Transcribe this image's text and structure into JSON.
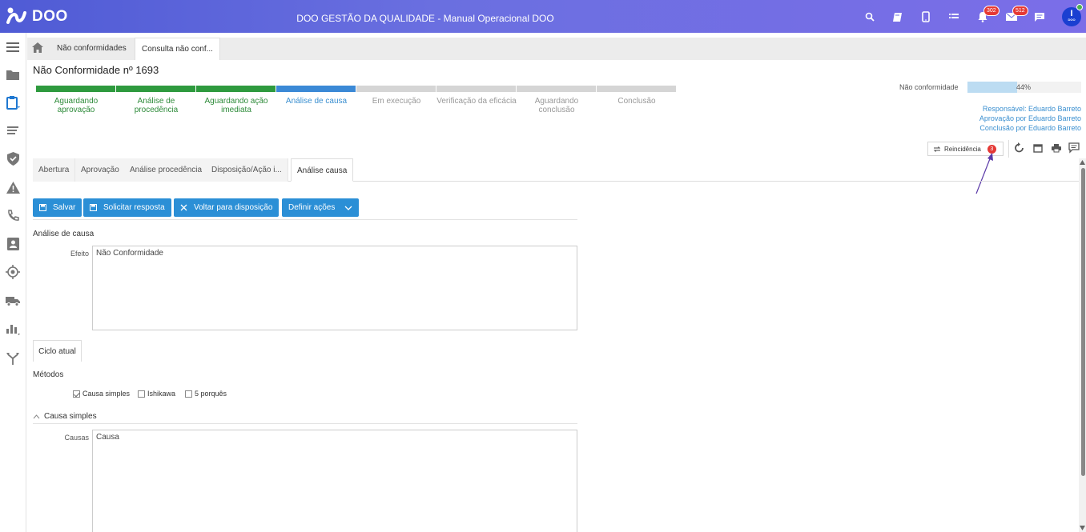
{
  "header": {
    "logo_text": "DOO",
    "title": "DOO GESTÃO DA QUALIDADE - Manual Operacional DOO",
    "notifications_count": "302",
    "messages_count": "512",
    "avatar_letter": "I",
    "avatar_sub": "DOO"
  },
  "breadcrumb": {
    "items": [
      "Não conformidades",
      "Consulta não conf..."
    ]
  },
  "page_title": "Não Conformidade nº 1693",
  "stepper": [
    {
      "label": "Aguardando aprovação",
      "state": "done"
    },
    {
      "label": "Análise de procedência",
      "state": "done"
    },
    {
      "label": "Aguardando ação imediata",
      "state": "done"
    },
    {
      "label": "Análise de causa",
      "state": "current"
    },
    {
      "label": "Em execução",
      "state": "pending"
    },
    {
      "label": "Verificação da eficácia",
      "state": "pending"
    },
    {
      "label": "Aguardando conclusão",
      "state": "pending"
    },
    {
      "label": "Conclusão",
      "state": "pending"
    }
  ],
  "progress": {
    "label": "Não conformidade",
    "percent_text": "44%",
    "percent": 44
  },
  "responsibles": {
    "responsavel": "Responsável: Eduardo Barreto",
    "aprovacao": "Aprovação por Eduardo Barreto",
    "conclusao": "Conclusão por Eduardo Barreto"
  },
  "reincidencia": {
    "label": "Reincidência",
    "count": "3"
  },
  "tabs": [
    "Abertura",
    "Aprovação",
    "Análise procedência",
    "Disposição/Ação i...",
    "Análise causa"
  ],
  "actions": {
    "save": "Salvar",
    "request": "Solicitar resposta",
    "back": "Voltar para disposição",
    "define": "Definir ações"
  },
  "analysis": {
    "section_title": "Análise de causa",
    "effect_label": "Efeito",
    "effect_value": "Não Conformidade",
    "cycle_tab": "Ciclo atual",
    "methods_title": "Métodos",
    "methods": [
      {
        "label": "Causa simples",
        "checked": true
      },
      {
        "label": "Ishikawa",
        "checked": false
      },
      {
        "label": "5 porquês",
        "checked": false
      }
    ],
    "simple_title": "Causa simples",
    "causes_label": "Causas",
    "causes_value": "Causa"
  },
  "colors": {
    "done": "#2e9a3e",
    "current": "#3b89d6",
    "pending": "#d5d5d5",
    "accent": "#2b8fd6"
  }
}
